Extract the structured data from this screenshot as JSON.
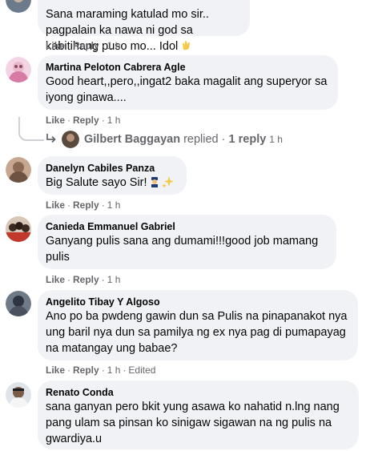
{
  "actions": {
    "like": "Like",
    "reply": "Reply",
    "dot": "·"
  },
  "comments": [
    {
      "name": "",
      "text": "Sana maraming katulad mo sir.. pagpalain ka nawa ni god sa kabitihang puso mo... Idol",
      "time": "1 h",
      "emoji": "clapping-hands"
    },
    {
      "name": "Martina Peloton Cabrera Agle",
      "text": "Good heart,,pero,,ingat2 baka magalit ang superyor sa iyong ginawa....",
      "time": "1 h"
    },
    {
      "name": "Danelyn Cabiles Panza",
      "text": "Big Salute sayo Sir!",
      "time": "1 h",
      "emoji": "police-officer sparkles"
    },
    {
      "name": "Canieda Emmanuel Gabriel",
      "text": "Ganyang pulis sana ang dumami!!!good job mamang pulis",
      "time": "1 h"
    },
    {
      "name": "Angelito Tibay Y Algoso",
      "text": "Ano po ba pwdeng gawin dun sa Pulis na pinapanakot nya ung baril nya dun sa pamilya ng ex nya pag di pumapayag na matangay ung babae?",
      "time": "1 h",
      "edited": "Edited"
    },
    {
      "name": "Renato Conda",
      "text": "sana ganyan pero bkit yung asawa ko nahatid n.lng nang pang ulam sa pinsan ko sinigaw sigawan na ng pulis na gwardiya.u",
      "time": ""
    }
  ],
  "reply_thread": {
    "name": "Gilbert Baggayan",
    "text": "replied",
    "count": "1 reply",
    "time": "1 h"
  }
}
